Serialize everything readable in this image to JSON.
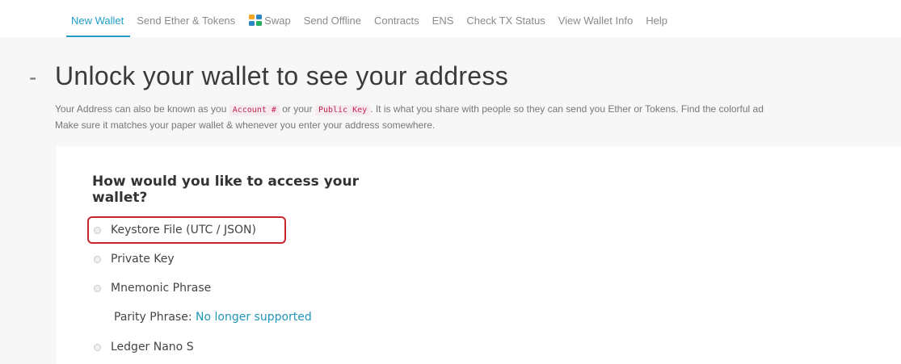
{
  "nav": {
    "items": [
      {
        "label": "New Wallet",
        "active": true
      },
      {
        "label": "Send Ether & Tokens"
      },
      {
        "label": "Swap",
        "icon": "swap-icon"
      },
      {
        "label": "Send Offline"
      },
      {
        "label": "Contracts"
      },
      {
        "label": "ENS"
      },
      {
        "label": "Check TX Status"
      },
      {
        "label": "View Wallet Info"
      },
      {
        "label": "Help"
      }
    ]
  },
  "header": {
    "dash": "-",
    "title": "Unlock your wallet to see your address"
  },
  "description": {
    "line1_part1": "Your Address can also be known as you",
    "code1": "Account #",
    "line1_part2": "or your",
    "code2": "Public Key",
    "line1_part3": ". It is what you share with people so they can send you Ether or Tokens. Find the colorful ad",
    "line2": "Make sure it matches your paper wallet & whenever you enter your address somewhere."
  },
  "access": {
    "question": "How would you like to access your wallet?",
    "options": [
      {
        "label": "Keystore File (UTC / JSON)",
        "highlighted": true
      },
      {
        "label": "Private Key"
      },
      {
        "label": "Mnemonic Phrase"
      },
      {
        "label": "Ledger Nano S"
      }
    ],
    "parity_label": "Parity Phrase:",
    "parity_link": "No longer supported"
  },
  "colors": {
    "accent": "#1f9ec6",
    "highlight_border": "#c9262c",
    "code_text": "#c7254e"
  }
}
